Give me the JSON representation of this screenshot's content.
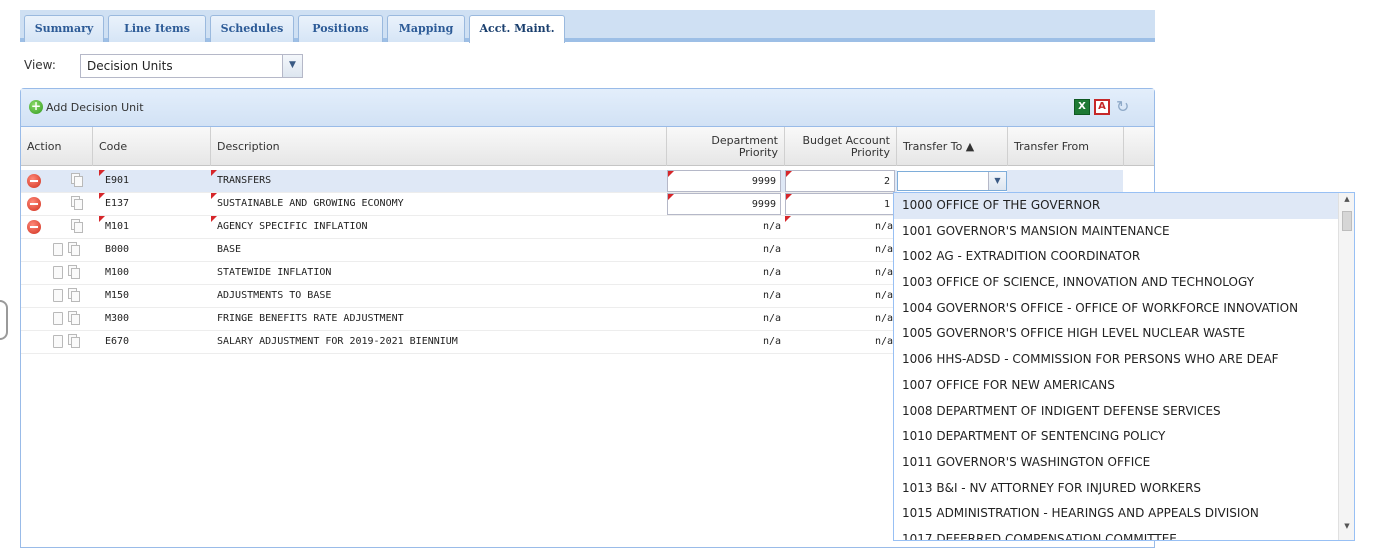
{
  "tabs": [
    {
      "label": "Summary"
    },
    {
      "label": "Line Items"
    },
    {
      "label": "Schedules"
    },
    {
      "label": "Positions"
    },
    {
      "label": "Mapping"
    },
    {
      "label": "Acct. Maint."
    }
  ],
  "view": {
    "label": "View:",
    "selected": "Decision Units"
  },
  "toolbar": {
    "add_label": "Add Decision Unit"
  },
  "columns": {
    "action": "Action",
    "code": "Code",
    "description": "Description",
    "dept_priority": "Department Priority",
    "budget_priority": "Budget Account Priority",
    "transfer_to": "Transfer To ▲",
    "transfer_from": "Transfer From"
  },
  "rows": [
    {
      "code": "E901",
      "description": "TRANSFERS",
      "dept_priority": "9999",
      "budget_priority": "2"
    },
    {
      "code": "E137",
      "description": "SUSTAINABLE AND GROWING ECONOMY",
      "dept_priority": "9999",
      "budget_priority": "1"
    },
    {
      "code": "M101",
      "description": "AGENCY SPECIFIC INFLATION",
      "dept_priority": "n/a",
      "budget_priority": "n/a"
    },
    {
      "code": "B000",
      "description": "BASE",
      "dept_priority": "n/a",
      "budget_priority": "n/a"
    },
    {
      "code": "M100",
      "description": "STATEWIDE INFLATION",
      "dept_priority": "n/a",
      "budget_priority": "n/a"
    },
    {
      "code": "M150",
      "description": "ADJUSTMENTS TO BASE",
      "dept_priority": "n/a",
      "budget_priority": "n/a"
    },
    {
      "code": "M300",
      "description": "FRINGE BENEFITS RATE ADJUSTMENT",
      "dept_priority": "n/a",
      "budget_priority": "n/a"
    },
    {
      "code": "E670",
      "description": "SALARY ADJUSTMENT FOR 2019-2021 BIENNIUM",
      "dept_priority": "n/a",
      "budget_priority": "n/a"
    }
  ],
  "transfer_options": [
    "1000 OFFICE OF THE GOVERNOR",
    "1001 GOVERNOR'S MANSION MAINTENANCE",
    "1002 AG - EXTRADITION COORDINATOR",
    "1003 OFFICE OF SCIENCE, INNOVATION AND TECHNOLOGY",
    "1004 GOVERNOR'S OFFICE - OFFICE OF WORKFORCE INNOVATION",
    "1005 GOVERNOR'S OFFICE HIGH LEVEL NUCLEAR WASTE",
    "1006 HHS-ADSD - COMMISSION FOR PERSONS WHO ARE DEAF",
    "1007 OFFICE FOR NEW AMERICANS",
    "1008 DEPARTMENT OF INDIGENT DEFENSE SERVICES",
    "1010 DEPARTMENT OF SENTENCING POLICY",
    "1011 GOVERNOR'S WASHINGTON OFFICE",
    "1013 B&I - NV ATTORNEY FOR INJURED WORKERS",
    "1015 ADMINISTRATION - HEARINGS AND APPEALS DIVISION",
    "1017 DEFERRED COMPENSATION COMMITTEE"
  ],
  "icons": {
    "add": "add-circle-icon",
    "delete": "delete-circle-icon",
    "copy": "copy-icon",
    "excel": "excel-export-icon",
    "pdf": "pdf-export-icon",
    "refresh": "refresh-icon"
  },
  "colors": {
    "accent": "#99bbe8",
    "selected_row": "#dfe8f6",
    "delete": "#d0301e",
    "add": "#2f9a1e"
  }
}
